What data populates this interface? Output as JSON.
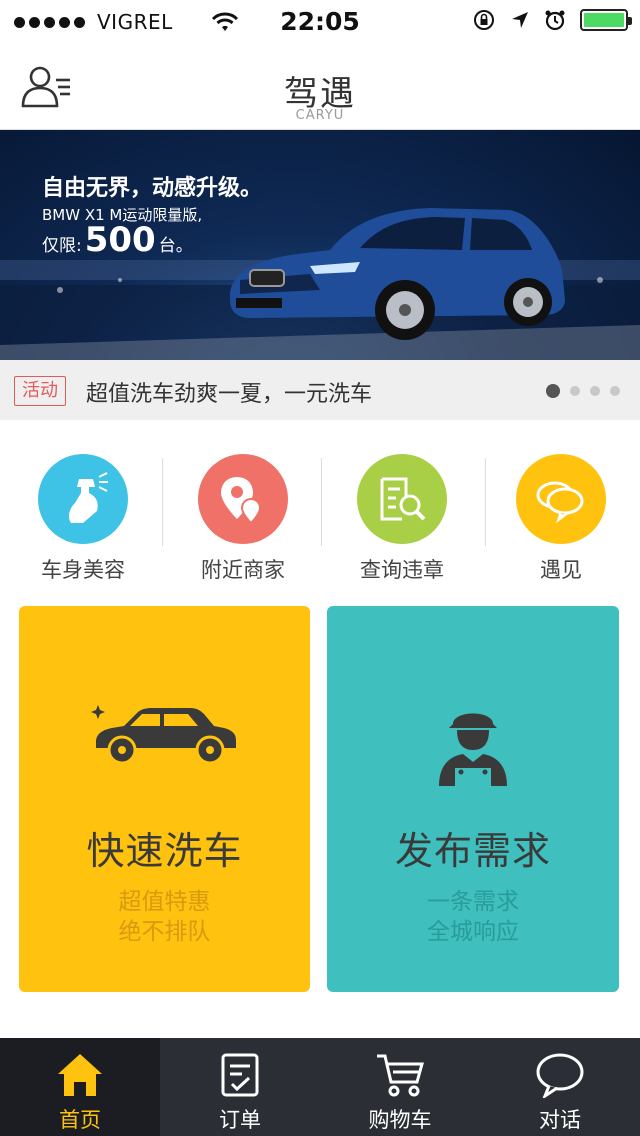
{
  "status_bar": {
    "carrier": "VIGREL",
    "time": "22:05",
    "battery_level": 1.0
  },
  "nav": {
    "title": "驾遇",
    "subtitle": "CARYU",
    "profile_icon": "user-list-icon"
  },
  "banner": {
    "headline": "自由无界，动感升级。",
    "line2": "BMW X1 M运动限量版,",
    "line3_prefix": "仅限:",
    "line3_number": "500",
    "line3_suffix": "台。",
    "plate_text": "BMW X1 M运动限量版"
  },
  "notice": {
    "tag": "活动",
    "text": "超值洗车劲爽一夏，一元洗车",
    "page_count": 4,
    "active_page": 1
  },
  "shortcuts": [
    {
      "label": "车身美容",
      "icon": "spray-bottle-icon",
      "color": "#3ec3e6"
    },
    {
      "label": "附近商家",
      "icon": "location-pin-icon",
      "color": "#f07167"
    },
    {
      "label": "查询违章",
      "icon": "search-document-icon",
      "color": "#a8cf45"
    },
    {
      "label": "遇见",
      "icon": "chat-bubbles-icon",
      "color": "#ffc20e"
    }
  ],
  "cards": {
    "wash": {
      "title": "快速洗车",
      "sub1": "超值特惠",
      "sub2": "绝不排队",
      "icon": "car-icon",
      "color": "#ffc20e"
    },
    "request": {
      "title": "发布需求",
      "sub1": "一条需求",
      "sub2": "全城响应",
      "icon": "mechanic-icon",
      "color": "#3fbfbd"
    }
  },
  "tabs": [
    {
      "label": "首页",
      "icon": "home-icon",
      "active": true
    },
    {
      "label": "订单",
      "icon": "order-list-icon",
      "active": false
    },
    {
      "label": "购物车",
      "icon": "cart-icon",
      "active": false
    },
    {
      "label": "对话",
      "icon": "speech-bubble-icon",
      "active": false
    }
  ],
  "colors": {
    "accent": "#ffc20e",
    "tab_bg": "#2b2e35",
    "tag_red": "#e25a5a"
  }
}
